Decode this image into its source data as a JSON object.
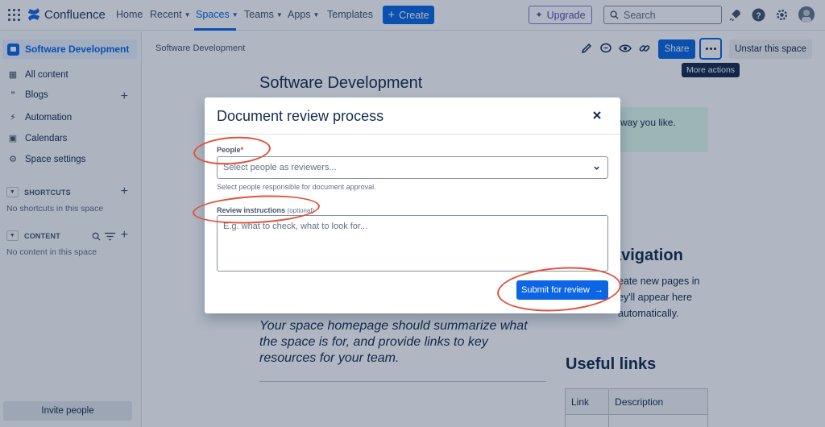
{
  "nav": {
    "brand": "Confluence",
    "items": [
      {
        "label": "Home",
        "has_chevron": false
      },
      {
        "label": "Recent",
        "has_chevron": true
      },
      {
        "label": "Spaces",
        "has_chevron": true,
        "active": true
      },
      {
        "label": "Teams",
        "has_chevron": true
      },
      {
        "label": "Apps",
        "has_chevron": true
      },
      {
        "label": "Templates",
        "has_chevron": false
      }
    ],
    "create_label": "Create",
    "upgrade_label": "Upgrade",
    "search_placeholder": "Search",
    "accent": "#0c66e4"
  },
  "sidebar": {
    "space_name": "Software Development",
    "items": [
      {
        "label": "All content",
        "icon": "grid-icon"
      },
      {
        "label": "Blogs",
        "icon": "quote-icon"
      },
      {
        "label": "Automation",
        "icon": "lightning-icon"
      },
      {
        "label": "Calendars",
        "icon": "calendar-icon"
      },
      {
        "label": "Space settings",
        "icon": "gear-icon"
      }
    ],
    "shortcuts_title": "SHORTCUTS",
    "shortcuts_empty": "No shortcuts in this space",
    "content_title": "CONTENT",
    "content_empty": "No content in this space",
    "invite_label": "Invite people"
  },
  "content": {
    "breadcrumb": "Software Development",
    "share_label": "Share",
    "unstar_label": "Unstar this space",
    "tooltip": "More actions",
    "page_title": "Software Development",
    "info_text": "way you like.",
    "nav_heading": "avigation",
    "nav_lines": [
      "eate new pages in",
      "ey'll appear here",
      "automatically."
    ],
    "quote": "Your space homepage should summarize what the space is for, and provide links to key resources for your team.",
    "links_heading": "Useful links",
    "table_headers": [
      "Link",
      "Description"
    ]
  },
  "modal": {
    "title": "Document review process",
    "people_label": "People",
    "people_required_mark": "*",
    "people_placeholder": "Select people as reviewers...",
    "people_helper": "Select people responsible for document approval.",
    "instructions_label": "Review instructions",
    "instructions_optional": "(optional)",
    "instructions_placeholder": "E.g. what to check, what to look for...",
    "submit_label": "Submit for review",
    "annotation_color": "#e2513a"
  }
}
